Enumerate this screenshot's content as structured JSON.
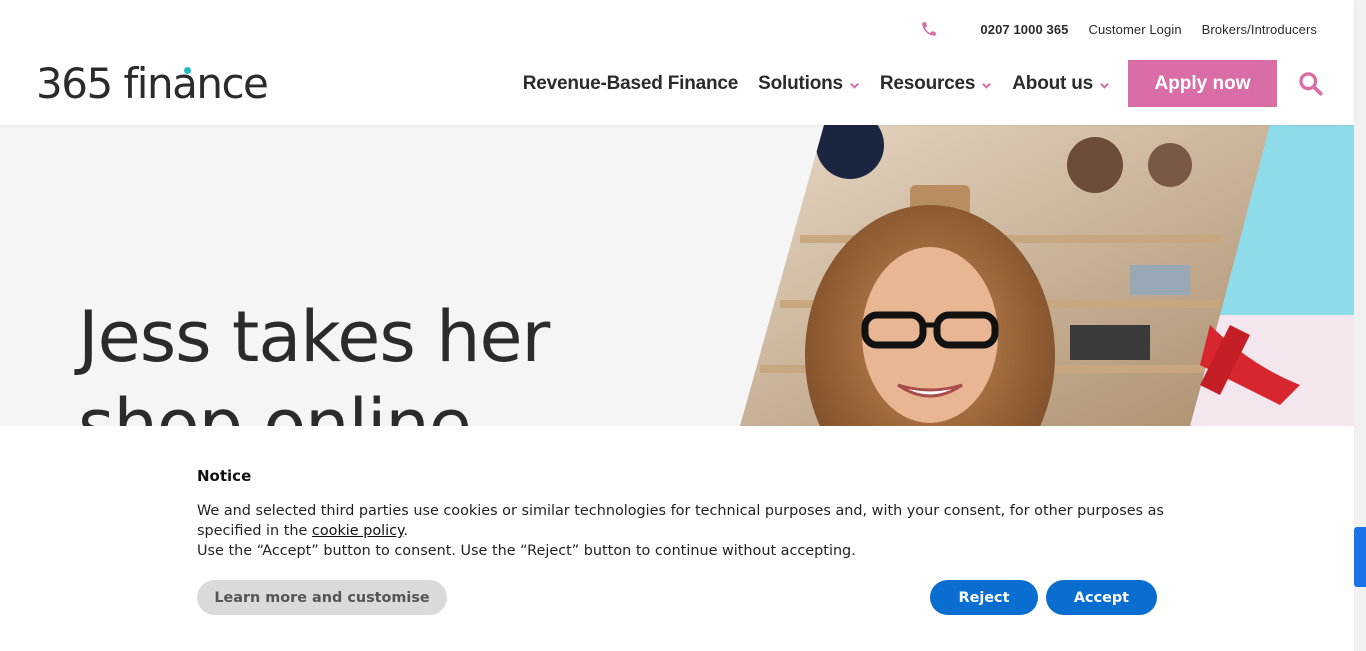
{
  "topbar": {
    "phone_icon": "phone-icon",
    "phone_number": "0207 1000 365",
    "customer_login": "Customer Login",
    "brokers": "Brokers/Introducers"
  },
  "logo": {
    "text": "365 finance",
    "accent_color": "#23b8c8"
  },
  "nav": {
    "revenue_based": "Revenue-Based Finance",
    "solutions": "Solutions",
    "resources": "Resources",
    "about_us": "About us",
    "apply_now": "Apply now",
    "search_icon": "search-icon",
    "chevron_icon": "chevron-down-icon",
    "accent_color": "#d96ea6"
  },
  "hero": {
    "title_line1": "Jess takes her",
    "title_line2": "shop online",
    "image": "woman-with-glasses-in-shop"
  },
  "cookie": {
    "title": "Notice",
    "text_before_link": "We and selected third parties use cookies or similar technologies for technical purposes and, with your consent, for other purposes as specified in the ",
    "link_text": "cookie policy",
    "text_after_link": ".",
    "line2": "Use the “Accept” button to consent. Use the “Reject” button to continue without accepting.",
    "learn_more": "Learn more and customise",
    "reject": "Reject",
    "accept": "Accept",
    "button_color": "#0a6ed1"
  }
}
